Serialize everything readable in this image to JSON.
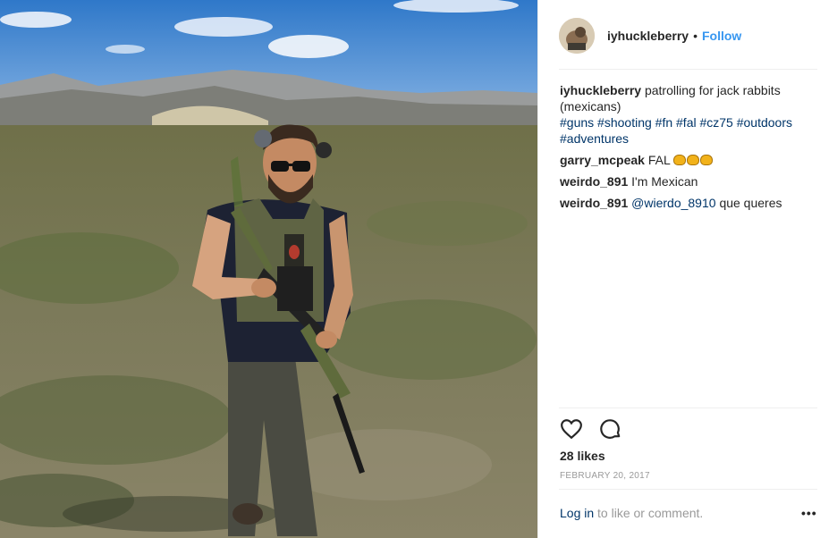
{
  "post": {
    "username": "iyhuckleberry",
    "separator": "•",
    "follow_label": "Follow",
    "caption": {
      "username": "iyhuckleberry",
      "text": "patrolling for jack rabbits (mexicans)",
      "hashtags": [
        "#guns",
        "#shooting",
        "#fn",
        "#fal",
        "#cz75",
        "#outdoors",
        "#adventures"
      ]
    },
    "comments": [
      {
        "username": "garry_mcpeak",
        "text": "FAL",
        "emoji": [
          "punch-emoji",
          "punch-emoji",
          "punch-emoji"
        ]
      },
      {
        "username": "weirdo_891",
        "text": "I'm Mexican"
      },
      {
        "username": "weirdo_891",
        "mention": "@wierdo_8910",
        "text": "que queres"
      }
    ],
    "likes": "28 likes",
    "date": "FEBRUARY 20, 2017",
    "footer": {
      "login_label": "Log in",
      "rest": "to like or comment."
    },
    "more_label": "•••"
  },
  "icons": {
    "like": "heart-outline-icon",
    "comment": "speech-bubble-icon",
    "more": "more-options-icon"
  },
  "colors": {
    "link": "#003569",
    "follow": "#3897f0",
    "muted": "#999999",
    "text": "#262626"
  }
}
